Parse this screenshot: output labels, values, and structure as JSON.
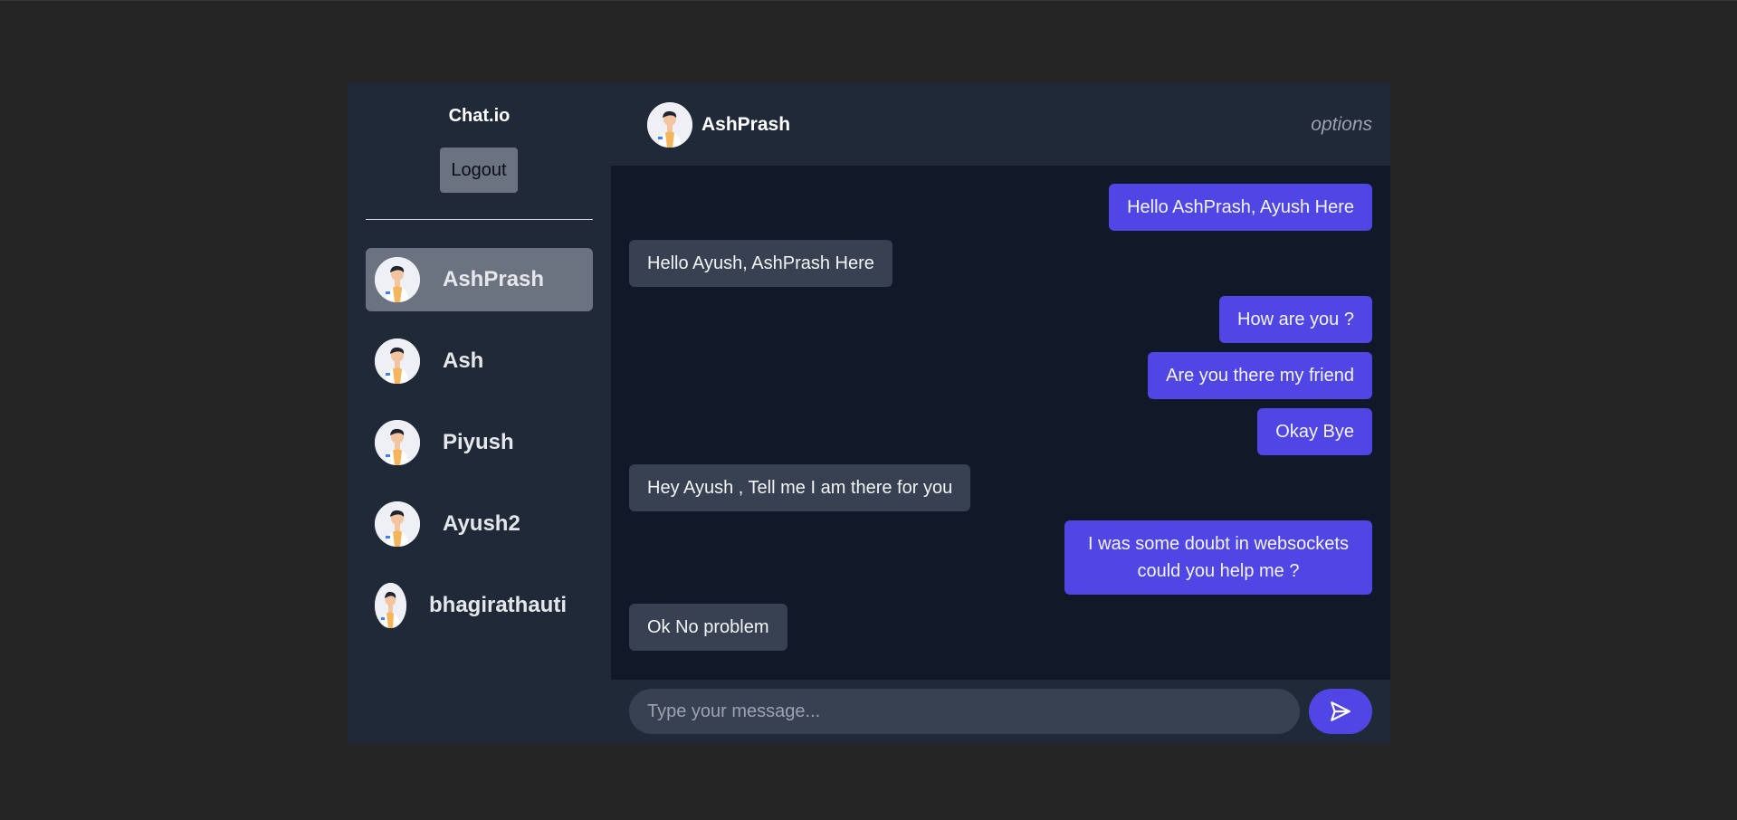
{
  "sidebar": {
    "brand": "Chat.io",
    "logout_label": "Logout",
    "users": [
      {
        "name": "AshPrash",
        "active": true,
        "avatar": "person-avatar-icon"
      },
      {
        "name": "Ash",
        "active": false,
        "avatar": "person-avatar-icon"
      },
      {
        "name": "Piyush",
        "active": false,
        "avatar": "person-avatar-icon"
      },
      {
        "name": "Ayush2",
        "active": false,
        "avatar": "person-avatar-icon"
      },
      {
        "name": "bhagirathauti",
        "active": false,
        "avatar": "person-avatar-icon"
      }
    ]
  },
  "chat": {
    "header": {
      "name": "AshPrash",
      "options_label": "options"
    },
    "messages": [
      {
        "text": "Hello AshPrash, Ayush Here",
        "direction": "sent"
      },
      {
        "text": "Hello Ayush, AshPrash Here",
        "direction": "received"
      },
      {
        "text": "How are you ?",
        "direction": "sent"
      },
      {
        "text": "Are you there my friend",
        "direction": "sent"
      },
      {
        "text": "Okay Bye",
        "direction": "sent"
      },
      {
        "text": "Hey Ayush , Tell me I am there for you",
        "direction": "received"
      },
      {
        "text": "I was some doubt in websockets could you help me ?",
        "direction": "sent"
      },
      {
        "text": "Ok No problem",
        "direction": "received"
      }
    ],
    "composer": {
      "placeholder": "Type your message...",
      "send_icon": "send-icon"
    }
  },
  "colors": {
    "accent": "#4f46e5",
    "panel": "#1f2937",
    "chat_bg": "#111827",
    "received_bubble": "#374151",
    "active_item": "#6b7280"
  }
}
